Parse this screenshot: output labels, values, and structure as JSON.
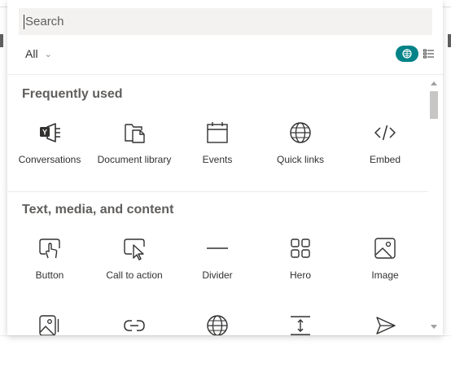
{
  "search": {
    "placeholder": "Search",
    "value": ""
  },
  "filter": {
    "label": "All"
  },
  "view": {
    "selected": "grid",
    "accent": "#038387"
  },
  "sections": [
    {
      "title": "Frequently used",
      "items": [
        {
          "label": "Conversations",
          "icon": "yammer-conversations-icon"
        },
        {
          "label": "Document library",
          "icon": "document-library-icon"
        },
        {
          "label": "Events",
          "icon": "calendar-icon"
        },
        {
          "label": "Quick links",
          "icon": "globe-icon"
        },
        {
          "label": "Embed",
          "icon": "code-icon"
        }
      ]
    },
    {
      "title": "Text, media, and content",
      "items": [
        {
          "label": "Button",
          "icon": "button-tap-icon"
        },
        {
          "label": "Call to action",
          "icon": "call-to-action-icon"
        },
        {
          "label": "Divider",
          "icon": "divider-line-icon"
        },
        {
          "label": "Hero",
          "icon": "hero-grid-icon"
        },
        {
          "label": "Image",
          "icon": "image-icon"
        },
        {
          "label": "",
          "icon": "image-gallery-icon"
        },
        {
          "label": "",
          "icon": "link-icon"
        },
        {
          "label": "",
          "icon": "globe-icon"
        },
        {
          "label": "",
          "icon": "spacer-icon"
        },
        {
          "label": "",
          "icon": "send-icon"
        }
      ]
    }
  ]
}
